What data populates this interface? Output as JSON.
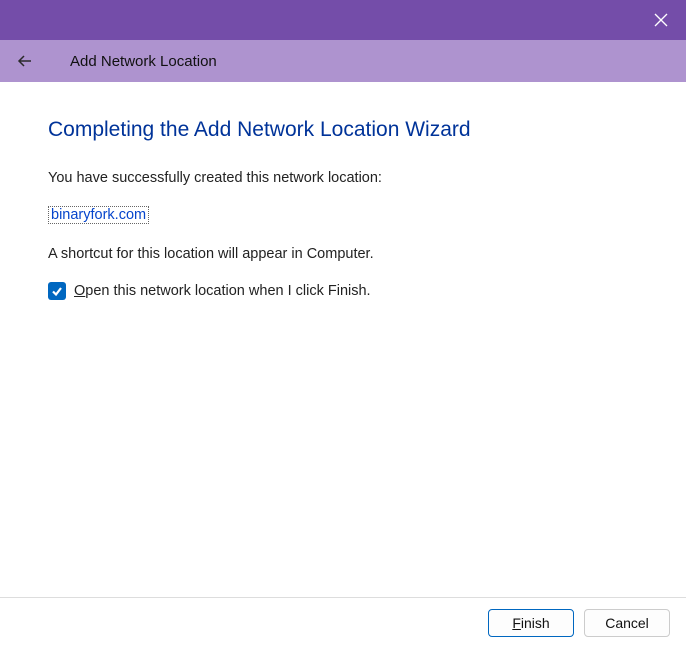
{
  "header": {
    "title": "Add Network Location"
  },
  "page": {
    "title": "Completing the Add Network Location Wizard",
    "successText": "You have successfully created this network location:",
    "locationName": "binaryfork.com",
    "shortcutText": "A shortcut for this location will appear in Computer."
  },
  "checkbox": {
    "checked": true,
    "labelPrefix": "O",
    "labelRest": "pen this network location when I click Finish."
  },
  "buttons": {
    "finishPrefix": "F",
    "finishRest": "inish",
    "cancel": "Cancel"
  }
}
